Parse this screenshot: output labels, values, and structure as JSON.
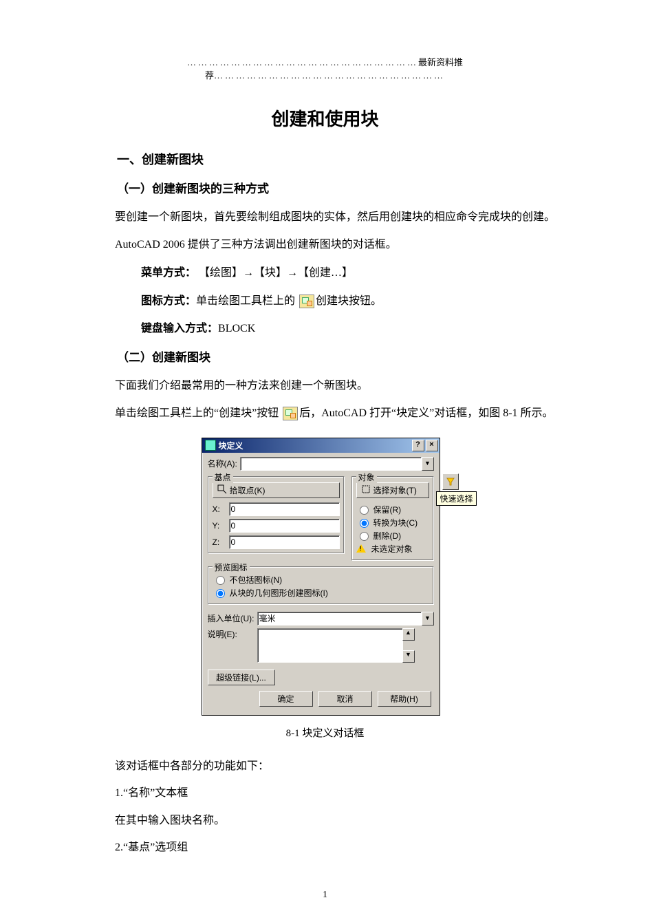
{
  "header_banner": "最新资料推荐",
  "doc_title": "创建和使用块",
  "section1": "一、创建新图块",
  "section1_1": "（一）创建新图块的三种方式",
  "para1": "要创建一个新图块，首先要绘制组成图块的实体，然后用创建块的相应命令完成块的创建。",
  "para2": "AutoCAD 2006 提供了三种方法调出创建新图块的对话框。",
  "method_menu_label": "菜单方式：",
  "method_menu_value": "【绘图】→【块】→【创建…】",
  "method_icon_label": "图标方式：",
  "method_icon_before": "单击绘图工具栏上的",
  "method_icon_after": "创建块按钮。",
  "method_kbd_label": "键盘输入方式：",
  "method_kbd_value": "BLOCK",
  "section1_2": "（二）创建新图块",
  "para3": "下面我们介绍最常用的一种方法来创建一个新图块。",
  "para4a": "单击绘图工具栏上的“创建块”按钮",
  "para4b": "后，AutoCAD 打开“块定义”对话框，如图 8-1 所示。",
  "dialog": {
    "title": "块定义",
    "name_label": "名称(A):",
    "name_value": "",
    "group_base": "基点",
    "pick_point": "拾取点(K)",
    "x_label": "X:",
    "x_value": "0",
    "y_label": "Y:",
    "y_value": "0",
    "z_label": "Z:",
    "z_value": "0",
    "group_obj": "对象",
    "select_obj": "选择对象(T)",
    "quick_select_tip": "快速选择",
    "opt_retain": "保留(R)",
    "opt_convert": "转换为块(C)",
    "opt_delete": "删除(D)",
    "no_sel": "未选定对象",
    "group_preview": "预览图标",
    "preview_none": "不包括图标(N)",
    "preview_geom": "从块的几何图形创建图标(I)",
    "insert_unit_label": "插入单位(U):",
    "insert_unit_value": "毫米",
    "desc_label": "说明(E):",
    "hyperlink": "超级链接(L)...",
    "ok": "确定",
    "cancel": "取消",
    "help": "帮助(H)"
  },
  "figure_caption": "8-1 块定义对话框",
  "para5": "该对话框中各部分的功能如下：",
  "item1": "1.“名称”文本框",
  "item1_desc": "在其中输入图块名称。",
  "item2": "2.“基点”选项组",
  "page_number": "1"
}
